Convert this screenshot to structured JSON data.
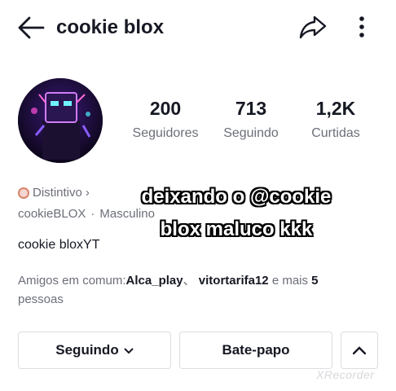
{
  "header": {
    "title": "cookie blox",
    "back_icon": "arrow-left-icon",
    "share_icon": "share-icon",
    "more_icon": "more-vertical-icon"
  },
  "profile": {
    "avatar_icon": "avatar",
    "stats": [
      {
        "value": "200",
        "label": "Seguidores"
      },
      {
        "value": "713",
        "label": "Seguindo"
      },
      {
        "value": "1,2K",
        "label": "Curtidas"
      }
    ],
    "badge_label": "Distintivo",
    "handle": "cookieBLOX",
    "separator": "·",
    "gender": "Masculino",
    "bio": "cookie bloxYT",
    "mutual": {
      "prefix": "Amigos em comum:",
      "friend1": "Alca_play",
      "joiner": "、",
      "friend2": "vitortarifa12",
      "middle": " e mais ",
      "count": "5",
      "suffix": "pessoas"
    }
  },
  "overlay": {
    "line1": "deixando o @cookie",
    "line2": "blox maluco kkk"
  },
  "actions": {
    "follow_label": "Seguindo",
    "chat_label": "Bate-papo",
    "expand_icon": "chevron-up-icon"
  },
  "watermark": "XRecorder",
  "colors": {
    "text_primary": "#161823",
    "text_secondary": "#6c6f78",
    "border": "#dcdde0",
    "avatar_glow": "#7b3df0"
  }
}
